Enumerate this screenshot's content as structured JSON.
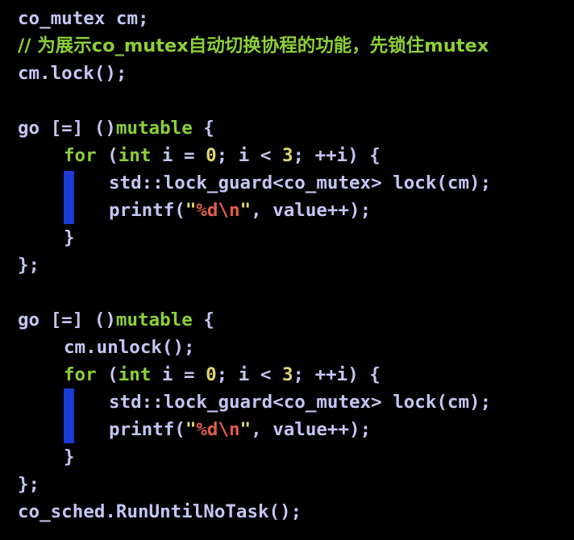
{
  "theme": {
    "background": "#000000",
    "foreground": "#c2c6f2",
    "keyword": "#8ccf38",
    "comment": "#8ccf38",
    "number": "#e3d66d",
    "string": "#e3d66d",
    "escape": "#e35c4c",
    "marker": "#1a3bd6"
  },
  "code": {
    "line1": {
      "text": "co_mutex cm;"
    },
    "line2": {
      "prefix": "// 为展示co_mutex自动切换协程的功能，先锁住mutex"
    },
    "line3": {
      "text": "cm.lock();"
    },
    "block1": {
      "go_head": "go [=] ()",
      "mutable": "mutable",
      "brace_open": " {",
      "for_kw": "for",
      "for_open": " (",
      "int_kw": "int",
      "for_mid1": " i = ",
      "zero": "0",
      "for_mid2": "; i < ",
      "three": "3",
      "for_tail": "; ++i) {",
      "guard": "std::lock_guard<co_mutex> lock(cm);",
      "printf_head": "printf(",
      "str_open": "\"",
      "fmt": "%d",
      "esc": "\\n",
      "str_close": "\"",
      "printf_tail": ", value++);",
      "inner_close": "}",
      "outer_close": "};"
    },
    "block2": {
      "go_head": "go [=] ()",
      "mutable": "mutable",
      "brace_open": " {",
      "unlock": "cm.unlock();",
      "for_kw": "for",
      "for_open": " (",
      "int_kw": "int",
      "for_mid1": " i = ",
      "zero": "0",
      "for_mid2": "; i < ",
      "three": "3",
      "for_tail": "; ++i) {",
      "guard": "std::lock_guard<co_mutex> lock(cm);",
      "printf_head": "printf(",
      "str_open": "\"",
      "fmt": "%d",
      "esc": "\\n",
      "str_close": "\"",
      "printf_tail": ", value++);",
      "inner_close": "}",
      "outer_close": "};"
    },
    "last_line": {
      "text": "co_sched.RunUntilNoTask();"
    }
  }
}
